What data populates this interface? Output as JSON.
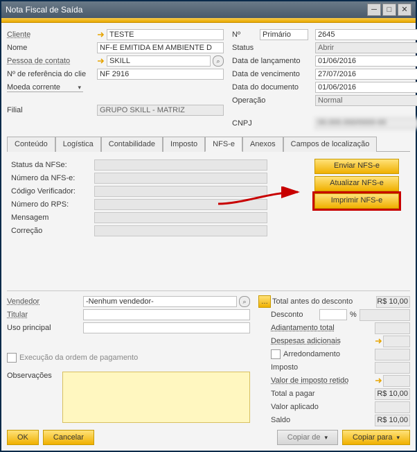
{
  "window": {
    "title": "Nota Fiscal de Saída"
  },
  "left": {
    "cliente_lbl": "Cliente",
    "cliente_val": "TESTE",
    "nome_lbl": "Nome",
    "nome_val": "NF-E EMITIDA EM AMBIENTE D",
    "contato_lbl": "Pessoa de contato",
    "contato_val": "SKILL",
    "ref_lbl": "Nº de referência do clie",
    "ref_val": "NF 2916",
    "moeda_lbl": "Moeda corrente",
    "filial_lbl": "Filial",
    "filial_val": "GRUPO SKILL - MATRIZ"
  },
  "right": {
    "num_lbl": "Nº",
    "num_type": "Primário",
    "num_val": "2645",
    "status_lbl": "Status",
    "status_val": "Abrir",
    "lanc_lbl": "Data de lançamento",
    "lanc_val": "01/06/2016",
    "venc_lbl": "Data de vencimento",
    "venc_val": "27/07/2016",
    "doc_lbl": "Data do documento",
    "doc_val": "01/06/2016",
    "oper_lbl": "Operação",
    "oper_val": "Normal",
    "cnpj_lbl": "CNPJ",
    "cnpj_val": "00.000.000/0000-00"
  },
  "tabs": {
    "t0": "Conteúdo",
    "t1": "Logística",
    "t2": "Contabilidade",
    "t3": "Imposto",
    "t4": "NFS-e",
    "t5": "Anexos",
    "t6": "Campos de localização"
  },
  "nfse": {
    "status_lbl": "Status da NFSe:",
    "numero_lbl": "Número da NFS-e:",
    "codver_lbl": "Código Verificador:",
    "rps_lbl": "Número do RPS:",
    "msg_lbl": "Mensagem",
    "corr_lbl": "Correção",
    "btn_enviar": "Enviar NFS-e",
    "btn_atualizar": "Atualizar NFS-e",
    "btn_imprimir": "Imprimir NFS-e"
  },
  "lower_left": {
    "vend_lbl": "Vendedor",
    "vend_val": "-Nenhum vendedor-",
    "tit_lbl": "Titular",
    "uso_lbl": "Uso principal",
    "exec_lbl": "Execução da ordem de pagamento",
    "obs_lbl": "Observações"
  },
  "totals": {
    "t_antes": "Total antes do desconto",
    "v_antes": "R$ 10,00",
    "t_desc": "Desconto",
    "pct": "%",
    "t_adiant": "Adiantamento total",
    "t_desp": "Despesas adicionais",
    "t_arred": "Arredondamento",
    "t_imp": "Imposto",
    "t_valimp": "Valor de imposto retido",
    "t_pagar": "Total a pagar",
    "v_pagar": "R$ 10,00",
    "t_aplic": "Valor aplicado",
    "t_saldo": "Saldo",
    "v_saldo": "R$ 10,00"
  },
  "footer": {
    "ok": "OK",
    "cancel": "Cancelar",
    "copyfrom": "Copiar de",
    "copyto": "Copiar para"
  }
}
